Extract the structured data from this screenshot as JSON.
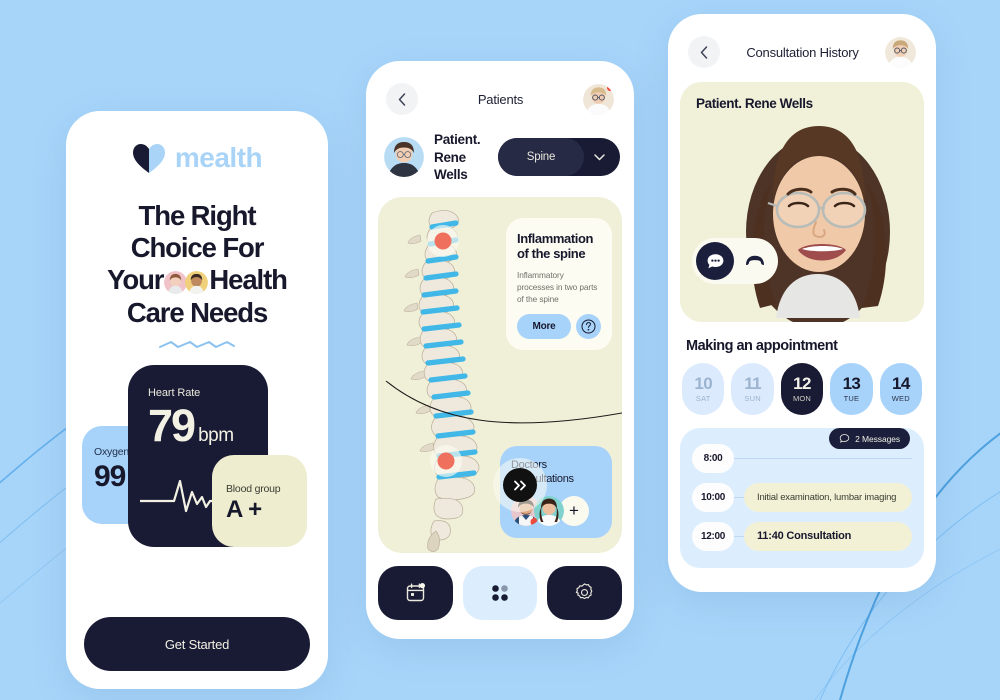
{
  "theme": {
    "bg": "#a7d5fa",
    "navy": "#181b33",
    "light_blue": "#a7d3fb",
    "pale_blue": "#dceefd",
    "cream": "#f0f0d8",
    "accent_red": "#ef4b3d"
  },
  "onboarding": {
    "logo": {
      "icon": "heart-icon",
      "text": "mealth"
    },
    "headline_parts": {
      "line1": "The Right",
      "line2": "Choice For",
      "line3_a": "Your",
      "line3_b": "Health",
      "line4": "Care Needs"
    },
    "metrics": {
      "oxygen": {
        "label": "Oxygen",
        "value": "99"
      },
      "heart_rate": {
        "label": "Heart Rate",
        "value": "79",
        "unit": "bpm"
      },
      "blood_group": {
        "label": "Blood group",
        "value": "A +"
      }
    },
    "cta": "Get Started"
  },
  "patients": {
    "header": {
      "title": "Patients",
      "back_icon": "chevron-left-icon",
      "avatar": "doctor-avatar"
    },
    "patient": {
      "label": "Patient.",
      "name": "Rene Wells"
    },
    "selector": {
      "value": "Spine",
      "chevron": "chevron-down-icon"
    },
    "diagnosis": {
      "title_line1": "Inflammation",
      "title_line2": "of the spine",
      "description": "Inflammatory processes in two parts of the spine",
      "more_label": "More",
      "help_icon": "question-mark-icon"
    },
    "next_icon": "double-chevron-right-icon",
    "doctors": {
      "title_line1": "Doctors",
      "title_line2": "Consultations",
      "add_label": "+"
    },
    "tabs": [
      {
        "name": "calendar",
        "icon": "calendar-icon",
        "active": false
      },
      {
        "name": "dashboard",
        "icon": "grid-icon",
        "active": true
      },
      {
        "name": "settings",
        "icon": "gear-icon",
        "active": false
      }
    ]
  },
  "consultation": {
    "header": {
      "title": "Consultation History",
      "back_icon": "chevron-left-icon",
      "avatar": "doctor-avatar"
    },
    "video": {
      "title": "Patient. Rene Wells",
      "chat_icon": "chat-bubble-icon",
      "end_call_icon": "phone-hangup-icon"
    },
    "appointment_title": "Making an appointment",
    "dates": [
      {
        "day": "10",
        "dow": "SAT",
        "state": "dim"
      },
      {
        "day": "11",
        "dow": "SUN",
        "state": "dim"
      },
      {
        "day": "12",
        "dow": "MON",
        "state": "selected"
      },
      {
        "day": "13",
        "dow": "TUE",
        "state": "normal"
      },
      {
        "day": "14",
        "dow": "WED",
        "state": "normal"
      }
    ],
    "messages_badge": {
      "icon": "chat-bubble-icon",
      "label": "2 Messages"
    },
    "schedule": [
      {
        "time": "8:00",
        "event": ""
      },
      {
        "time": "10:00",
        "event": "Initial examination, lumbar imaging"
      },
      {
        "time": "12:00",
        "event": "11:40  Consultation"
      }
    ]
  }
}
